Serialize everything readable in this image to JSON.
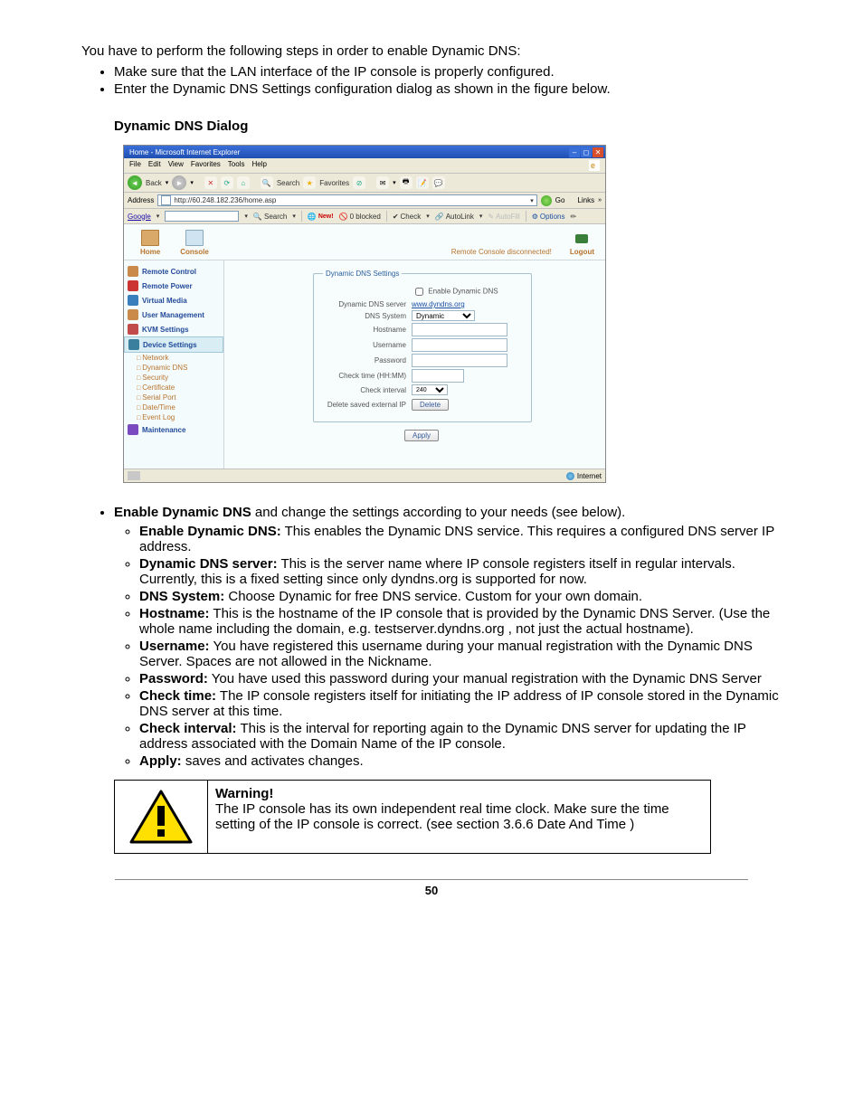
{
  "intro": "You have to perform the following steps in order to enable Dynamic DNS:",
  "intro_bullets": [
    "Make sure that the LAN interface of the IP console is properly configured.",
    "Enter the Dynamic DNS Settings configuration dialog as shown in the figure below."
  ],
  "dialog_title": "Dynamic DNS Dialog",
  "browser": {
    "title": "Home - Microsoft Internet Explorer",
    "menus": [
      "File",
      "Edit",
      "View",
      "Favorites",
      "Tools",
      "Help"
    ],
    "toolbar": {
      "back": "Back",
      "search": "Search",
      "favorites": "Favorites"
    },
    "address_label": "Address",
    "address_value": "http://60.248.182.236/home.asp",
    "go": "Go",
    "links": "Links",
    "google": {
      "brand": "Google",
      "search": "Search",
      "new": "New!",
      "blocked": "0 blocked",
      "check": "Check",
      "autolink": "AutoLink",
      "autofill": "AutoFill",
      "options": "Options"
    },
    "header": {
      "home": "Home",
      "console": "Console",
      "status": "Remote Console disconnected!",
      "logout": "Logout"
    },
    "sidebar": {
      "items": [
        "Remote Control",
        "Remote Power",
        "Virtual Media",
        "User Management",
        "KVM Settings",
        "Device Settings"
      ],
      "subitems": [
        "Network",
        "Dynamic DNS",
        "Security",
        "Certificate",
        "Serial Port",
        "Date/Time",
        "Event Log"
      ],
      "last": "Maintenance"
    },
    "form": {
      "legend": "Dynamic DNS Settings",
      "enable": "Enable Dynamic DNS",
      "server_label": "Dynamic DNS server",
      "server_link": "www.dyndns.org",
      "system_label": "DNS System",
      "system_value": "Dynamic",
      "hostname_label": "Hostname",
      "username_label": "Username",
      "password_label": "Password",
      "checktime_label": "Check time (HH:MM)",
      "checkinterval_label": "Check interval",
      "checkinterval_value": "240",
      "delete_label": "Delete saved external IP",
      "delete_btn": "Delete",
      "apply_btn": "Apply"
    },
    "statusbar": {
      "zone": "Internet"
    }
  },
  "options_leadin": " and change the settings according to your needs (see below).",
  "options_head": "Enable Dynamic DNS",
  "options": [
    {
      "term": "Enable Dynamic DNS:",
      "desc": " This enables the Dynamic DNS service. This requires a configured DNS server IP address."
    },
    {
      "term": "Dynamic DNS server:",
      "desc": " This is the server name where IP console registers itself in regular intervals. Currently, this is a fixed setting since only dyndns.org is supported for now."
    },
    {
      "term": "DNS System:",
      "desc": " Choose Dynamic for free DNS service. Custom for your own domain."
    },
    {
      "term": "Hostname:",
      "desc": " This is the hostname of the IP console that is provided by the Dynamic DNS Server. (Use the whole name including the domain, e.g. testserver.dyndns.org , not just the actual hostname)."
    },
    {
      "term": "Username:",
      "desc": " You have registered this username during your manual registration with the Dynamic DNS Server. Spaces are not allowed in the Nickname."
    },
    {
      "term": "Password:",
      "desc": " You have used this password during your manual registration with the Dynamic DNS Server"
    },
    {
      "term": "Check time:",
      "desc": " The IP console registers itself for initiating the IP address of IP console stored in the Dynamic DNS server at this time."
    },
    {
      "term": "Check interval:",
      "desc": " This is the interval for reporting again to the Dynamic DNS server for updating the IP address associated with the Domain Name of the IP console."
    },
    {
      "term": "Apply:",
      "desc": " saves and activates changes."
    }
  ],
  "warning": {
    "title": "Warning!",
    "body": "The IP console has its own independent real time clock. Make sure the time setting of the IP console is correct. (see section 3.6.6 Date And Time )"
  },
  "page_number": "50"
}
